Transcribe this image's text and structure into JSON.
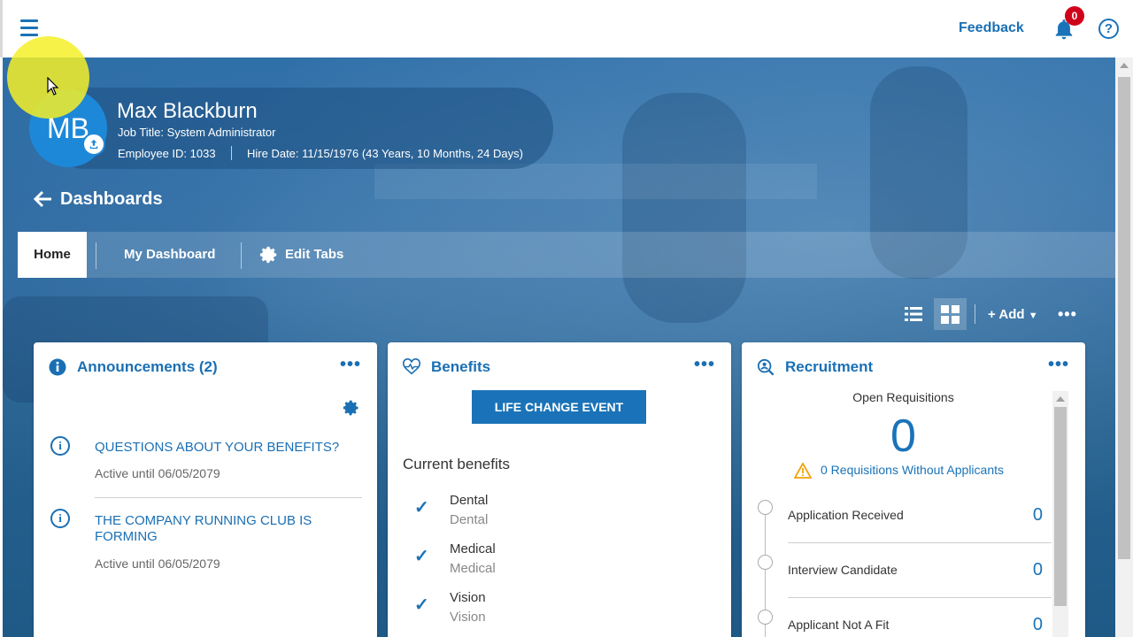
{
  "topbar": {
    "menu_icon": "hamburger-menu-icon",
    "feedback_label": "Feedback",
    "notification_count": "0",
    "help_label": "?"
  },
  "profile": {
    "initials": "MB",
    "name": "Max Blackburn",
    "job_title": "Job Title: System Administrator",
    "employee_id": "Employee ID: 1033",
    "hire_date": "Hire Date: 11/15/1976 (43 Years, 10 Months, 24 Days)"
  },
  "nav": {
    "back_label": "Dashboards",
    "tabs": [
      {
        "label": "Home",
        "active": true
      },
      {
        "label": "My Dashboard",
        "active": false
      },
      {
        "label": "Edit Tabs",
        "active": false
      }
    ]
  },
  "toolbar": {
    "add_label": "+ Add",
    "more_label": "•••"
  },
  "announcements": {
    "title": "Announcements (2)",
    "more_label": "•••",
    "items": [
      {
        "title": "QUESTIONS ABOUT YOUR BENEFITS?",
        "active_until": "Active until 06/05/2079"
      },
      {
        "title": "THE COMPANY RUNNING CLUB IS FORMING",
        "active_until": "Active until 06/05/2079"
      }
    ]
  },
  "benefits": {
    "title": "Benefits",
    "more_label": "•••",
    "button_label": "LIFE CHANGE EVENT",
    "section_label": "Current benefits",
    "items": [
      {
        "name": "Dental",
        "sub": "Dental"
      },
      {
        "name": "Medical",
        "sub": "Medical"
      },
      {
        "name": "Vision",
        "sub": "Vision"
      }
    ]
  },
  "recruitment": {
    "title": "Recruitment",
    "more_label": "•••",
    "open_requisitions_label": "Open Requisitions",
    "open_requisitions_count": "0",
    "without_applicants_label": "0 Requisitions Without Applicants",
    "stages": [
      {
        "label": "Application Received",
        "count": "0"
      },
      {
        "label": "Interview Candidate",
        "count": "0"
      },
      {
        "label": "Applicant Not A Fit",
        "count": "0"
      }
    ]
  },
  "colors": {
    "brand_blue": "#1a73b8",
    "badge_red": "#d0021b",
    "warning_amber": "#f0a30a"
  }
}
